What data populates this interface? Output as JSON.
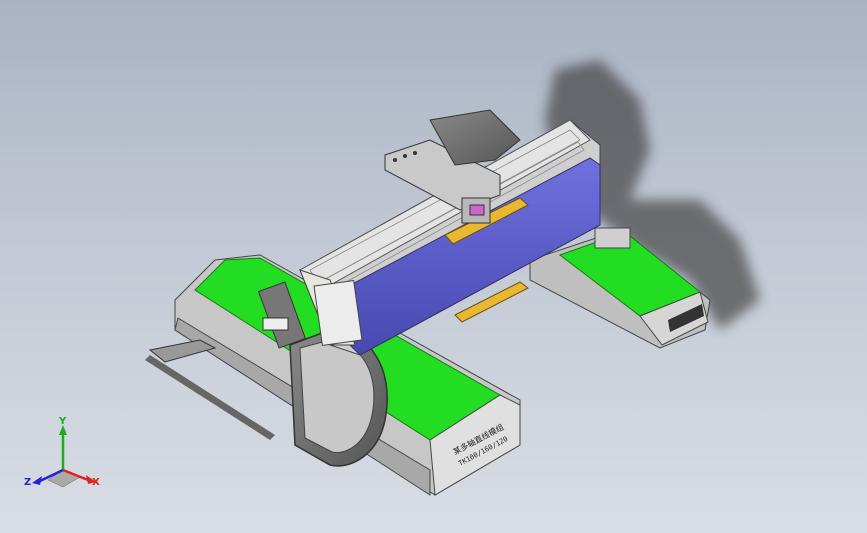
{
  "viewport": {
    "background_top": "#a9b3c3",
    "background_bottom": "#d9dde4"
  },
  "model": {
    "name": "gantry-xyz-robot",
    "nameplate_line1": "某多轴直线模组",
    "nameplate_line2": "TK100/160/120",
    "colors": {
      "green": "#22dd22",
      "blue": "#5a5acc",
      "yellow": "#e8b830",
      "frame": "#d8d8d8",
      "dark": "#555555"
    }
  },
  "triad": {
    "x_label": "X",
    "y_label": "Y",
    "z_label": "Z",
    "x_color": "#dd2222",
    "y_color": "#22aa22",
    "z_color": "#2222dd"
  }
}
